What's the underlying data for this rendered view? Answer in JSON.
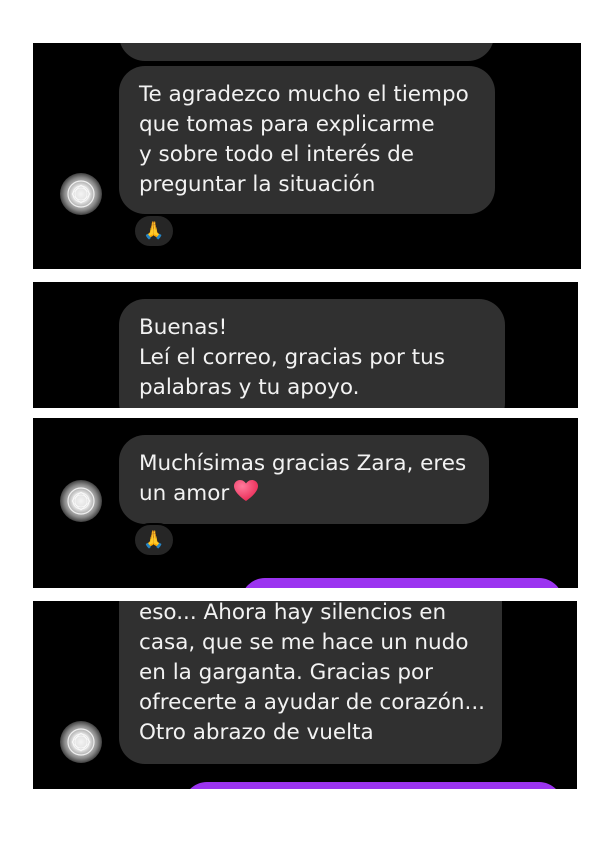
{
  "panels": [
    {
      "messages": [
        {
          "lines": [
            "Te agradezco mucho el tiempo",
            "que tomas para explicarme",
            "y sobre todo el interés de",
            "preguntar la situación"
          ]
        }
      ],
      "reaction": "🙏"
    },
    {
      "messages": [
        {
          "lines": [
            "Buenas!",
            "Leí el correo, gracias por tus",
            "palabras y tu apoyo."
          ]
        }
      ]
    },
    {
      "messages": [
        {
          "lines": [
            "Muchísimas gracias Zara, eres",
            "un amor"
          ],
          "emoji_icon": "heart-emoji"
        }
      ],
      "reaction": "🙏"
    },
    {
      "messages": [
        {
          "lines": [
            "eso... Ahora hay silencios en",
            "casa, que se me hace un nudo",
            "en la garganta. Gracias por",
            "ofrecerte a ayudar de corazón...",
            "Otro abrazo de vuelta"
          ]
        }
      ]
    }
  ],
  "colors": {
    "incoming_bubble": "#303030",
    "outgoing_bubble": "#9b34f0",
    "background": "#000000",
    "text": "#f2f2f2"
  }
}
